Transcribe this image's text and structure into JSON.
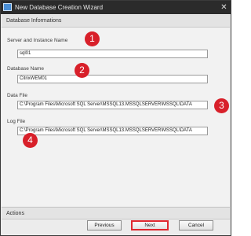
{
  "window": {
    "title": "New Database Creation Wizard",
    "close_glyph": "✕"
  },
  "groups": {
    "info_header": "Database Informations",
    "actions_header": "Actions"
  },
  "fields": {
    "server": {
      "label": "Server and Instance Name",
      "value": "sql01"
    },
    "database": {
      "label": "Database Name",
      "value": "CitrixWEM01"
    },
    "data_file": {
      "label": "Data File",
      "value": "C:\\Program Files\\Microsoft SQL Server\\MSSQL13.MSSQLSERVER\\MSSQL\\DATA"
    },
    "log_file": {
      "label": "Log File",
      "value": "C:\\Program Files\\Microsoft SQL Server\\MSSQL13.MSSQLSERVER\\MSSQL\\DATA"
    }
  },
  "annotations": [
    "1",
    "2",
    "3",
    "4"
  ],
  "buttons": {
    "previous": "Previous",
    "next": "Next",
    "cancel": "Cancel"
  },
  "colors": {
    "annotation_red": "#d8202a",
    "highlight_red": "#e0282f",
    "titlebar": "#2b2b2b"
  },
  "icons": {
    "app": "wizard-app-icon",
    "close": "close-icon"
  }
}
